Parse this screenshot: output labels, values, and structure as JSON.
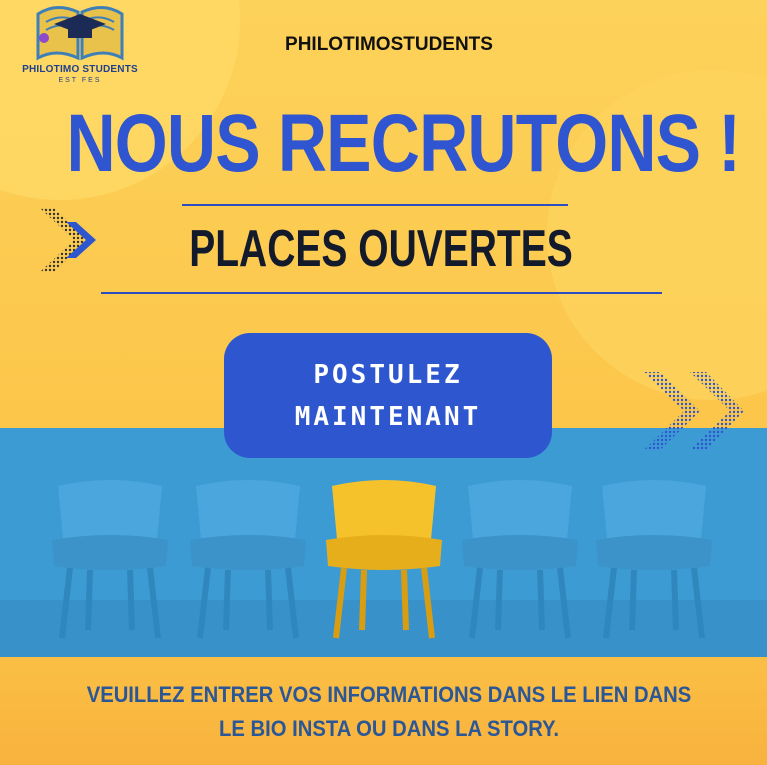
{
  "logo": {
    "name": "PHILOTIMO STUDENTS",
    "sub": "EST FES"
  },
  "brand": "PHILOTIMOSTUDENTS",
  "headline": "NOUS RECRUTONS !",
  "subheadline": "PLACES OUVERTES",
  "cta": {
    "line1": "POSTULEZ",
    "line2": "MAINTENANT"
  },
  "footer": {
    "line1": "VEUILLEZ ENTRER VOS INFORMATIONS DANS LE LIEN DANS",
    "line2": "LE BIO INSTA OU DANS LA STORY."
  },
  "colors": {
    "background": "#fcc64a",
    "headline": "#2f55d0",
    "cta": "#2d56cf",
    "wall": "#3d9bd3",
    "chair_blue": "#4aa6dc",
    "chair_highlight": "#f5c22c",
    "footer_text": "#2b5797"
  },
  "icons": [
    "graduation-cap-book-logo",
    "chevron-arrows",
    "chairs-illustration"
  ]
}
